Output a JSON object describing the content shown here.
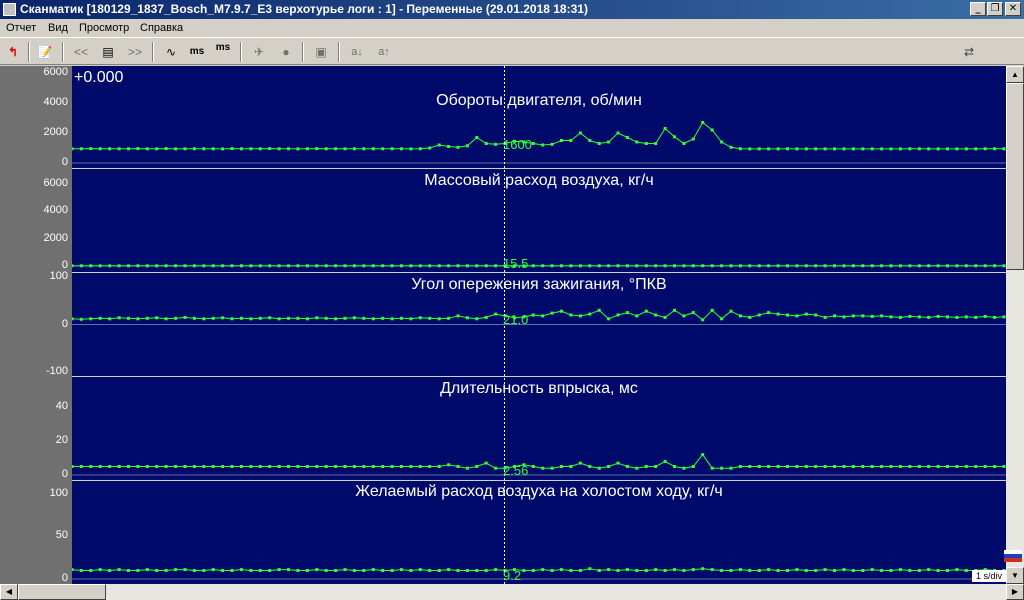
{
  "window": {
    "title": "Сканматик [180129_1837_Bosch_M7.9.7_E3 верхотурье логи : 1] - Переменные (29.01.2018  18:31)",
    "minimize_label": "_",
    "maximize_label": "❐",
    "close_label": "✕"
  },
  "menu": {
    "items": [
      "Отчет",
      "Вид",
      "Просмотр",
      "Справка"
    ]
  },
  "toolbar": {
    "icons": [
      "back-arrow-icon",
      "report-icon",
      "rewind-icon",
      "list-icon",
      "forward-icon",
      "wave-icon",
      "ms-minus-icon",
      "ms-plus-icon",
      "pin-icon",
      "record-icon",
      "save-icon",
      "a-down-icon",
      "a-up-icon",
      "usb-icon"
    ],
    "ms_label": "ms",
    "a_down_label": "a↓",
    "a_up_label": "a↑",
    "prev_label": "<<",
    "next_label": ">>"
  },
  "plot": {
    "offset_label": "+0.000",
    "scale_label": "1 s/div",
    "colors": {
      "background": "#000a6a",
      "trace": "#33ff33",
      "grid": "#ffffff"
    }
  },
  "chart_data": [
    {
      "type": "line",
      "title": "Обороты  двигателя, об/мин",
      "ylim": [
        0,
        6000
      ],
      "yticks": [
        "6000",
        "4000",
        "2000",
        "0"
      ],
      "current_value": "1600",
      "values": [
        950,
        950,
        960,
        950,
        950,
        950,
        950,
        960,
        950,
        950,
        960,
        940,
        950,
        950,
        950,
        950,
        940,
        960,
        950,
        950,
        950,
        960,
        950,
        950,
        940,
        950,
        960,
        950,
        950,
        950,
        950,
        950,
        950,
        950,
        950,
        950,
        940,
        950,
        1000,
        1200,
        1100,
        1050,
        1150,
        1700,
        1300,
        1250,
        1300,
        1450,
        1400,
        1300,
        1200,
        1250,
        1500,
        1500,
        2000,
        1500,
        1300,
        1400,
        2000,
        1700,
        1400,
        1300,
        1300,
        2300,
        1750,
        1300,
        1600,
        2700,
        2200,
        1400,
        1050,
        950,
        940,
        940,
        940,
        940,
        950,
        940,
        940,
        940,
        940,
        940,
        940,
        940,
        940,
        940,
        940,
        940,
        940,
        950,
        950,
        940,
        940,
        940,
        940,
        940,
        940,
        950,
        950,
        950
      ]
    },
    {
      "type": "line",
      "title": "Массовый расход воздуха, кг/ч",
      "ylim": [
        0,
        7000
      ],
      "yticks": [
        "6000",
        "4000",
        "2000",
        "0"
      ],
      "current_value": "15.5",
      "values": [
        16,
        16,
        16,
        16,
        16,
        16,
        16,
        16,
        16,
        16,
        16,
        16,
        16,
        16,
        16,
        16,
        16,
        16,
        16,
        16,
        16,
        16,
        16,
        16,
        16,
        16,
        16,
        16,
        16,
        16,
        16,
        16,
        16,
        16,
        16,
        16,
        16,
        16,
        16,
        16,
        16,
        16,
        16,
        16,
        16,
        16,
        16,
        16,
        16,
        16,
        16,
        16,
        16,
        16,
        16,
        16,
        16,
        16,
        16,
        16,
        16,
        16,
        16,
        16,
        16,
        16,
        16,
        16,
        16,
        16,
        16,
        16,
        16,
        16,
        16,
        16,
        16,
        16,
        16,
        16,
        16,
        16,
        16,
        16,
        16,
        16,
        16,
        16,
        16,
        16,
        16,
        16,
        16,
        16,
        16,
        16,
        16,
        16,
        16,
        16
      ]
    },
    {
      "type": "line",
      "title": "Угол опережения зажигания, °ПКВ",
      "ylim": [
        -100,
        100
      ],
      "yticks": [
        "100",
        "0",
        "-100"
      ],
      "current_value": "21.0",
      "values": [
        12,
        11,
        12,
        13,
        12,
        14,
        13,
        12,
        13,
        14,
        12,
        13,
        15,
        13,
        12,
        13,
        14,
        12,
        13,
        12,
        13,
        14,
        12,
        13,
        13,
        12,
        14,
        13,
        12,
        13,
        14,
        13,
        12,
        13,
        12,
        13,
        12,
        14,
        13,
        12,
        13,
        18,
        14,
        12,
        15,
        22,
        18,
        14,
        16,
        20,
        18,
        24,
        28,
        20,
        18,
        22,
        30,
        12,
        20,
        25,
        18,
        28,
        20,
        15,
        30,
        18,
        25,
        10,
        30,
        12,
        28,
        18,
        15,
        20,
        25,
        22,
        20,
        18,
        22,
        20,
        15,
        18,
        16,
        18,
        18,
        17,
        18,
        16,
        15,
        17,
        16,
        15,
        17,
        16,
        15,
        16,
        15,
        17,
        15,
        16
      ]
    },
    {
      "type": "line",
      "title": "Длительность впрыска, мс",
      "ylim": [
        0,
        50
      ],
      "yticks": [
        "40",
        "20",
        "0"
      ],
      "current_value": "2.56",
      "values": [
        5,
        5,
        5,
        5,
        5,
        5,
        5,
        5,
        5,
        5,
        5,
        5,
        5,
        5,
        5,
        5,
        5,
        5,
        5,
        5,
        5,
        5,
        5,
        5,
        5,
        5,
        5,
        5,
        5,
        5,
        5,
        5,
        5,
        5,
        5,
        5,
        5,
        5,
        5,
        5,
        6,
        5,
        4,
        5,
        7,
        4,
        4,
        5,
        6,
        5,
        4,
        4,
        5,
        5,
        7,
        5,
        4,
        5,
        7,
        5,
        4,
        5,
        5,
        8,
        5,
        4,
        5,
        12,
        4,
        4,
        4,
        5,
        5,
        5,
        5,
        5,
        5,
        5,
        5,
        5,
        5,
        5,
        5,
        5,
        5,
        5,
        5,
        5,
        5,
        5,
        5,
        5,
        5,
        5,
        5,
        5,
        5,
        5,
        5,
        5
      ]
    },
    {
      "type": "line",
      "title": "Желаемый расход воздуха на холостом ходу, кг/ч",
      "ylim": [
        0,
        110
      ],
      "yticks": [
        "100",
        "50",
        "0"
      ],
      "current_value": "9.2",
      "values": [
        11,
        10,
        10,
        11,
        10,
        11,
        10,
        10,
        11,
        10,
        10,
        11,
        11,
        10,
        10,
        11,
        10,
        10,
        11,
        10,
        10,
        10,
        11,
        11,
        10,
        10,
        11,
        10,
        10,
        11,
        10,
        10,
        11,
        10,
        10,
        11,
        10,
        11,
        10,
        10,
        11,
        10,
        10,
        10,
        10,
        11,
        10,
        11,
        10,
        10,
        11,
        10,
        11,
        10,
        10,
        12,
        10,
        11,
        10,
        11,
        10,
        10,
        11,
        10,
        11,
        10,
        11,
        12,
        11,
        10,
        10,
        11,
        10,
        10,
        11,
        10,
        10,
        11,
        10,
        10,
        11,
        10,
        11,
        10,
        10,
        11,
        10,
        10,
        11,
        10,
        10,
        11,
        10,
        10,
        11,
        10,
        10,
        11,
        10,
        10
      ]
    }
  ]
}
